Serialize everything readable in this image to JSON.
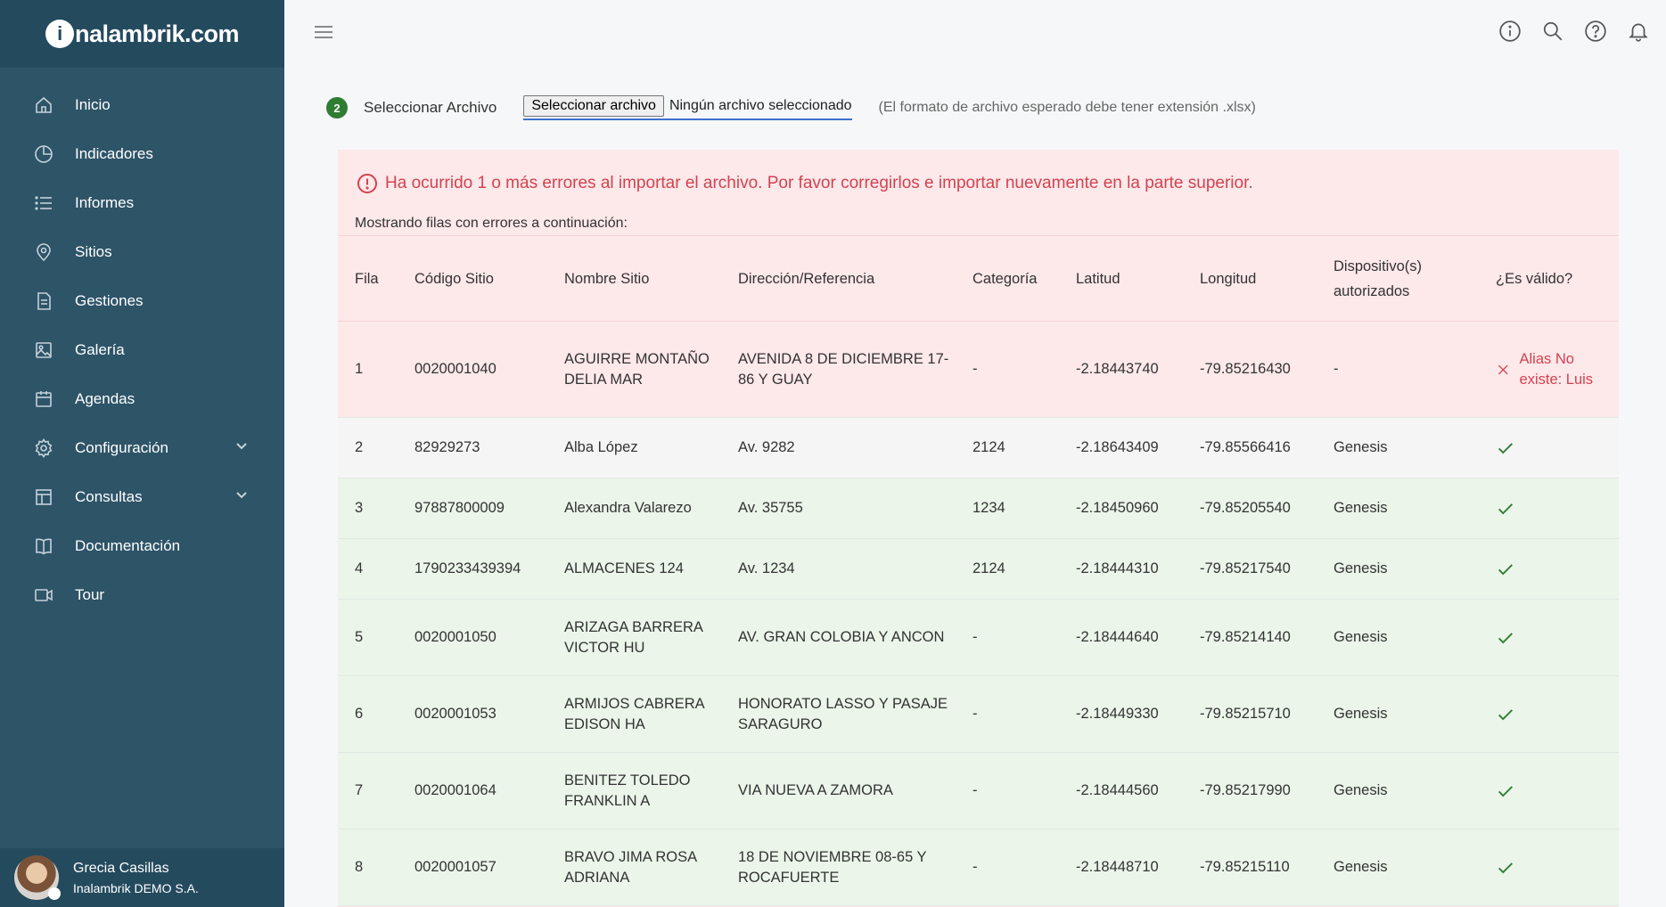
{
  "sidebar": {
    "logo_initial": "i",
    "logo_text": "nalambrik.com",
    "items": [
      {
        "label": "Inicio",
        "icon": "home-icon"
      },
      {
        "label": "Indicadores",
        "icon": "pie-chart-icon"
      },
      {
        "label": "Informes",
        "icon": "list-icon"
      },
      {
        "label": "Sitios",
        "icon": "map-pin-icon"
      },
      {
        "label": "Gestiones",
        "icon": "document-icon"
      },
      {
        "label": "Galería",
        "icon": "image-icon"
      },
      {
        "label": "Agendas",
        "icon": "calendar-icon"
      },
      {
        "label": "Configuración",
        "icon": "gear-icon"
      },
      {
        "label": "Consultas",
        "icon": "table-icon"
      },
      {
        "label": "Documentación",
        "icon": "book-icon"
      },
      {
        "label": "Tour",
        "icon": "video-icon"
      }
    ],
    "user": {
      "name": "Grecia Casillas",
      "company": "Inalambrik DEMO S.A."
    }
  },
  "topbar": {
    "icons": [
      "menu-icon",
      "info-icon",
      "search-icon",
      "help-icon",
      "bell-icon"
    ]
  },
  "file_select": {
    "step": "2",
    "label": "Seleccionar Archivo",
    "button_label": "Seleccionar archivo",
    "status": "Ningún archivo seleccionado",
    "hint": "(El formato de archivo esperado debe tener extensión .xlsx)"
  },
  "errors": {
    "message": "Ha ocurrido 1 o más errores al importar el archivo. Por favor corregirlos e importar nuevamente en la parte superior.",
    "showing": "Mostrando filas con errores a continuación:"
  },
  "table": {
    "headers": {
      "fila": "Fila",
      "codigo": "Código Sitio",
      "nombre": "Nombre Sitio",
      "direccion": "Dirección/Referencia",
      "categoria": "Categoría",
      "latitud": "Latitud",
      "longitud": "Longitud",
      "dispositivos_1": "Dispositivo(s)",
      "dispositivos_2": "autorizados",
      "valido": "¿Es válido?"
    },
    "rows": [
      {
        "fila": "1",
        "codigo": "0020001040",
        "nombre": "AGUIRRE MONTAÑO DELIA MAR",
        "direccion": "AVENIDA 8 DE DICIEMBRE 17-86 Y GUAY",
        "categoria": "-",
        "latitud": "-2.18443740",
        "longitud": "-79.85216430",
        "dispositivos": "-",
        "valido": false,
        "error": "Alias No existe: Luis"
      },
      {
        "fila": "2",
        "codigo": "82929273",
        "nombre": "Alba López",
        "direccion": "Av. 9282",
        "categoria": "2124",
        "latitud": "-2.18643409",
        "longitud": "-79.85566416",
        "dispositivos": "Genesis",
        "valido": true,
        "error": ""
      },
      {
        "fila": "3",
        "codigo": "97887800009",
        "nombre": "Alexandra Valarezo",
        "direccion": "Av. 35755",
        "categoria": "1234",
        "latitud": "-2.18450960",
        "longitud": "-79.85205540",
        "dispositivos": "Genesis",
        "valido": true,
        "error": ""
      },
      {
        "fila": "4",
        "codigo": "1790233439394",
        "nombre": "ALMACENES 124",
        "direccion": "Av. 1234",
        "categoria": "2124",
        "latitud": "-2.18444310",
        "longitud": "-79.85217540",
        "dispositivos": "Genesis",
        "valido": true,
        "error": ""
      },
      {
        "fila": "5",
        "codigo": "0020001050",
        "nombre": "ARIZAGA BARRERA VICTOR HU",
        "direccion": "AV. GRAN COLOBIA Y ANCON",
        "categoria": "-",
        "latitud": "-2.18444640",
        "longitud": "-79.85214140",
        "dispositivos": "Genesis",
        "valido": true,
        "error": ""
      },
      {
        "fila": "6",
        "codigo": "0020001053",
        "nombre": "ARMIJOS CABRERA EDISON HA",
        "direccion": "HONORATO LASSO Y PASAJE SARAGURO",
        "categoria": "-",
        "latitud": "-2.18449330",
        "longitud": "-79.85215710",
        "dispositivos": "Genesis",
        "valido": true,
        "error": ""
      },
      {
        "fila": "7",
        "codigo": "0020001064",
        "nombre": "BENITEZ TOLEDO FRANKLIN A",
        "direccion": "VIA NUEVA A ZAMORA",
        "categoria": "-",
        "latitud": "-2.18444560",
        "longitud": "-79.85217990",
        "dispositivos": "Genesis",
        "valido": true,
        "error": ""
      },
      {
        "fila": "8",
        "codigo": "0020001057",
        "nombre": "BRAVO JIMA ROSA ADRIANA",
        "direccion": "18 DE NOVIEMBRE 08-65 Y ROCAFUERTE",
        "categoria": "-",
        "latitud": "-2.18448710",
        "longitud": "-79.85215110",
        "dispositivos": "Genesis",
        "valido": true,
        "error": ""
      }
    ]
  },
  "colors": {
    "sidebar": "#2e5468",
    "sidebar_dark": "#244a5e",
    "error": "#d2434f",
    "success": "#2e7d32"
  }
}
